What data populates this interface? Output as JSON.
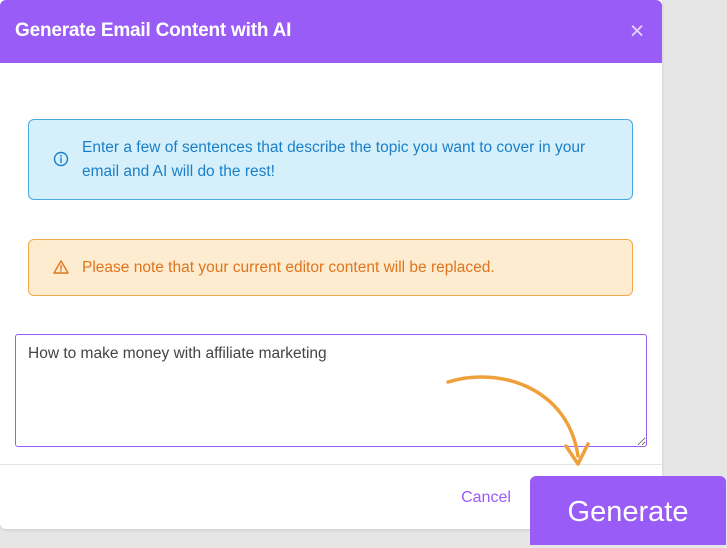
{
  "modal": {
    "title": "Generate Email Content with AI",
    "close_icon": "close-icon"
  },
  "alerts": {
    "info": {
      "icon": "info-circle-icon",
      "text": "Enter a few of sentences that describe the topic you want to cover in your email and AI will do the rest!"
    },
    "warning": {
      "icon": "warning-triangle-icon",
      "text": "Please note that your current editor content will be replaced."
    }
  },
  "prompt": {
    "value": "How to make money with affiliate marketing"
  },
  "footer": {
    "cancel_label": "Cancel",
    "generate_label": "Generate"
  },
  "annotation": {
    "arrow_icon": "curved-arrow-icon",
    "color": "#f0a03a"
  },
  "colors": {
    "accent": "#9a5cf6",
    "info_bg": "#d6f0fb",
    "info_text": "#1a7fc8",
    "warning_bg": "#fdeccf",
    "warning_text": "#e0741f"
  }
}
